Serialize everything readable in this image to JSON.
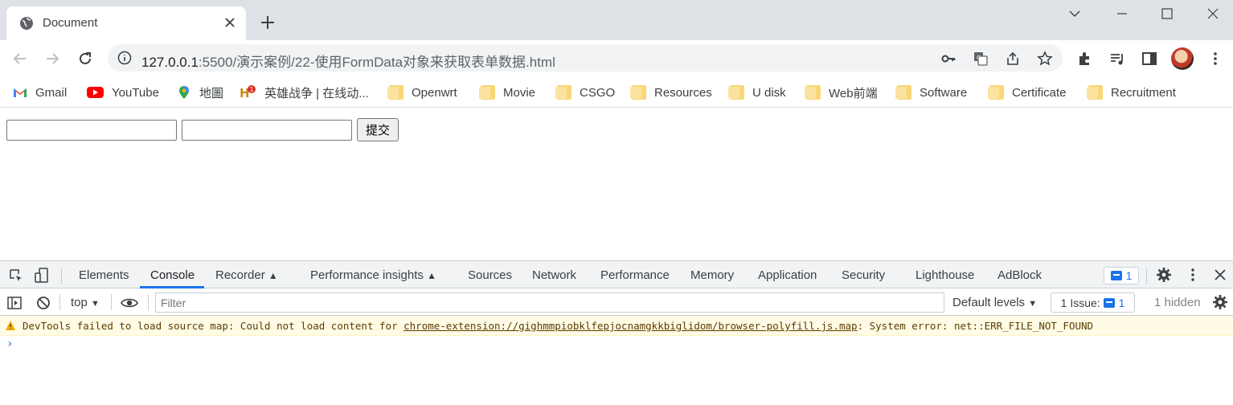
{
  "browser": {
    "tab": {
      "title": "Document"
    },
    "address": {
      "host": "127.0.0.1",
      "path": ":5500/演示案例/22-使用FormData对象来获取表单数据.html"
    }
  },
  "bookmarks": [
    {
      "label": "Gmail",
      "icon": "gmail-icon"
    },
    {
      "label": "YouTube",
      "icon": "youtube-icon"
    },
    {
      "label": "地圖",
      "icon": "maps-icon"
    },
    {
      "label": "英雄战争 | 在线动...",
      "icon": "game-icon"
    },
    {
      "label": "Openwrt",
      "icon": "folder-icon"
    },
    {
      "label": "Movie",
      "icon": "folder-icon"
    },
    {
      "label": "CSGO",
      "icon": "folder-icon"
    },
    {
      "label": "Resources",
      "icon": "folder-icon"
    },
    {
      "label": "U disk",
      "icon": "folder-icon"
    },
    {
      "label": "Web前端",
      "icon": "folder-icon"
    },
    {
      "label": "Software",
      "icon": "folder-icon"
    },
    {
      "label": "Certificate",
      "icon": "folder-icon"
    },
    {
      "label": "Recruitment",
      "icon": "folder-icon"
    }
  ],
  "page": {
    "input1_value": "",
    "input2_value": "",
    "submit_label": "提交"
  },
  "devtools": {
    "tabs": [
      "Elements",
      "Console",
      "Recorder",
      "Performance insights",
      "Sources",
      "Network",
      "Performance",
      "Memory",
      "Application",
      "Security",
      "Lighthouse",
      "AdBlock"
    ],
    "active_tab": "Console",
    "message_count": "1",
    "context": "top",
    "filter_placeholder": "Filter",
    "levels": "Default levels",
    "issues_label": "1 Issue:",
    "issues_count": "1",
    "hidden": "1 hidden",
    "warning": {
      "prefix": "DevTools failed to load source map: Could not load content for ",
      "link": "chrome-extension://gighmmpiobklfepjocnamgkkbiglidom/browser-polyfill.js.map",
      "suffix": ": System error: net::ERR_FILE_NOT_FOUND"
    },
    "prompt": "›"
  },
  "colors": {
    "accent": "#1a73e8",
    "warning_bg": "#fffbe5",
    "tabstrip": "#dee1e6"
  }
}
